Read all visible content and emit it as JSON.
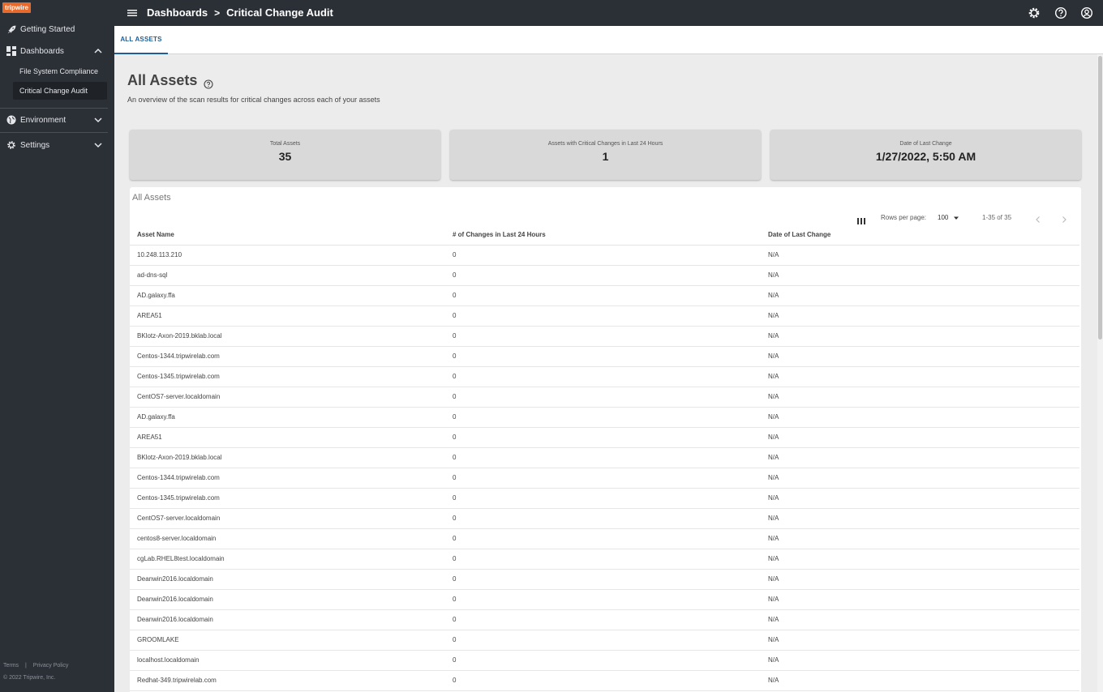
{
  "sidebar": {
    "logo": "tripwire",
    "items": [
      {
        "label": "Getting Started",
        "icon": "rocket-icon"
      },
      {
        "label": "Dashboards",
        "icon": "dashboard-icon"
      },
      {
        "label": "Environment",
        "icon": "globe-icon"
      },
      {
        "label": "Settings",
        "icon": "gear-icon"
      }
    ],
    "sub_items": [
      {
        "label": "File System Compliance"
      },
      {
        "label": "Critical Change Audit"
      }
    ],
    "footer": {
      "terms": "Terms",
      "sep": "|",
      "privacy": "Privacy Policy",
      "copyright": "© 2022 Tripwire, Inc."
    }
  },
  "header": {
    "breadcrumb": [
      "Dashboards",
      "Critical Change Audit"
    ],
    "separator": ">"
  },
  "tabs": [
    {
      "label": "ALL ASSETS"
    }
  ],
  "page": {
    "title": "All Assets",
    "description": "An overview of the scan results for critical changes across each of your assets"
  },
  "stats": [
    {
      "label": "Total Assets",
      "value": "35"
    },
    {
      "label": "Assets with Critical Changes in Last 24 Hours",
      "value": "1"
    },
    {
      "label": "Date of Last Change",
      "value": "1/27/2022, 5:50 AM"
    }
  ],
  "table": {
    "title": "All Assets",
    "rows_per_page_label": "Rows per page:",
    "rows_per_page_value": "100",
    "range": "1-35 of 35",
    "columns": [
      "Asset Name",
      "# of Changes in Last 24 Hours",
      "Date of Last Change"
    ],
    "rows": [
      [
        "10.248.113.210",
        "0",
        "N/A"
      ],
      [
        "ad-dns-sql",
        "0",
        "N/A"
      ],
      [
        "AD.galaxy.ffa",
        "0",
        "N/A"
      ],
      [
        "AREA51",
        "0",
        "N/A"
      ],
      [
        "BKlotz-Axon-2019.bklab.local",
        "0",
        "N/A"
      ],
      [
        "Centos-1344.tripwirelab.com",
        "0",
        "N/A"
      ],
      [
        "Centos-1345.tripwirelab.com",
        "0",
        "N/A"
      ],
      [
        "CentOS7-server.localdomain",
        "0",
        "N/A"
      ],
      [
        "AD.galaxy.ffa",
        "0",
        "N/A"
      ],
      [
        "AREA51",
        "0",
        "N/A"
      ],
      [
        "BKlotz-Axon-2019.bklab.local",
        "0",
        "N/A"
      ],
      [
        "Centos-1344.tripwirelab.com",
        "0",
        "N/A"
      ],
      [
        "Centos-1345.tripwirelab.com",
        "0",
        "N/A"
      ],
      [
        "CentOS7-server.localdomain",
        "0",
        "N/A"
      ],
      [
        "centos8-server.localdomain",
        "0",
        "N/A"
      ],
      [
        "cgLab.RHEL8test.localdomain",
        "0",
        "N/A"
      ],
      [
        "Deanwin2016.localdomain",
        "0",
        "N/A"
      ],
      [
        "Deanwin2016.localdomain",
        "0",
        "N/A"
      ],
      [
        "Deanwin2016.localdomain",
        "0",
        "N/A"
      ],
      [
        "GROOMLAKE",
        "0",
        "N/A"
      ],
      [
        "localhost.localdomain",
        "0",
        "N/A"
      ],
      [
        "Redhat-349.tripwirelab.com",
        "0",
        "N/A"
      ]
    ]
  }
}
